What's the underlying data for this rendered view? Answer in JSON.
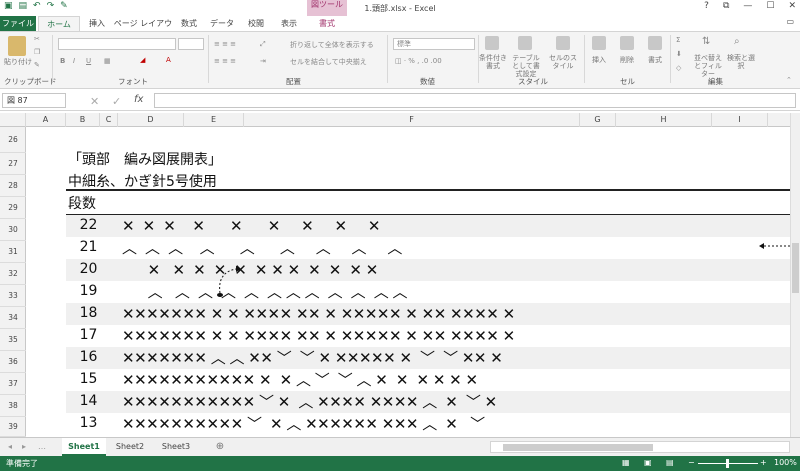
{
  "window": {
    "title": "1.頭部.xlsx - Excel",
    "contextual_group": "図ツール",
    "controls": [
      "?",
      "⧉",
      "—",
      "☐",
      "✕"
    ]
  },
  "tabs": [
    "ファイル",
    "ホーム",
    "挿入",
    "ページ レイアウト",
    "数式",
    "データ",
    "校閲",
    "表示",
    "書式"
  ],
  "ribbon": {
    "clipboard": {
      "paste": "貼り付け",
      "label": "クリップボード"
    },
    "font": {
      "label": "フォント",
      "bold": "B",
      "italic": "I",
      "underline": "U"
    },
    "alignment": {
      "wrap": "折り返して全体を表示する",
      "merge": "セルを結合して中央揃え",
      "label": "配置"
    },
    "number": {
      "format": "標準",
      "label": "数値"
    },
    "styles": {
      "conditional": "条件付き書式",
      "table": "テーブルとして書式設定",
      "cell": "セルのスタイル",
      "label": "スタイル"
    },
    "cells": {
      "insert": "挿入",
      "delete": "削除",
      "format": "書式",
      "label": "セル"
    },
    "editing": {
      "sort": "並べ替えとフィルター",
      "find": "検索と選択",
      "label": "編集"
    }
  },
  "formula": {
    "namebox": "図 87",
    "fx": "fx",
    "value": ""
  },
  "columns": [
    "A",
    "B",
    "C",
    "D",
    "E",
    "F",
    "G",
    "H",
    "I"
  ],
  "rows": [
    "26",
    "27",
    "28",
    "29",
    "30",
    "31",
    "32",
    "33",
    "34",
    "35",
    "36",
    "37",
    "38",
    "39"
  ],
  "sheet": {
    "title": "「頭部　編み図展開表」",
    "subtitle": "中細糸、かぎ針5号使用",
    "header": "段数",
    "stitch_rows": [
      {
        "num": "22",
        "stitches": "✕  ✕  ✕    ✕      ✕      ✕     ✕     ✕     ✕"
      },
      {
        "num": "21",
        "stitches": "︿  ︿  ︿    ︿      ︿      ︿     ︿     ︿     ︿"
      },
      {
        "num": "20",
        "stitches": "      ✕   ✕  ✕  ✕  ✕  ✕ ✕ ✕  ✕  ✕  ✕ ✕"
      },
      {
        "num": "19",
        "stitches": "      ︿   ︿  ︿  ︿  ︿  ︿ ︿ ︿  ︿  ︿  ︿ ︿"
      },
      {
        "num": "18",
        "stitches": "✕✕✕✕✕✕✕ ✕ ✕ ✕✕✕✕ ✕✕ ✕ ✕✕✕✕✕ ✕ ✕✕ ✕✕✕✕ ✕"
      },
      {
        "num": "17",
        "stitches": "✕✕✕✕✕✕✕ ✕ ✕ ✕✕✕✕ ✕✕ ✕ ✕✕✕✕✕ ✕ ✕✕ ✕✕✕✕ ✕"
      },
      {
        "num": "16",
        "stitches": "✕✕✕✕✕✕✕ ︿ ︿ ✕✕ ﹀  ﹀ ✕ ✕✕✕✕✕ ✕  ﹀  ﹀ ✕✕ ✕"
      },
      {
        "num": "15",
        "stitches": "✕✕✕✕✕✕✕✕✕✕✕ ✕  ✕ ︿ ﹀  ﹀ ︿ ✕  ✕  ✕ ✕ ✕ ✕"
      },
      {
        "num": "14",
        "stitches": "✕✕✕✕✕✕✕✕✕✕✕ ﹀ ✕  ︿ ✕✕✕✕ ✕✕✕✕ ︿  ✕  ﹀ ✕"
      },
      {
        "num": "13",
        "stitches": "✕✕✕✕✕✕✕✕✕✕ ﹀  ✕ ︿ ✕✕✕✕✕✕ ✕✕✕ ︿  ✕   ﹀"
      }
    ]
  },
  "sheet_tabs": [
    "Sheet1",
    "Sheet2",
    "Sheet3"
  ],
  "add_sheet": "⊕",
  "status": {
    "ready": "準備完了",
    "zoom": "100%"
  },
  "colors": {
    "accent": "#217346",
    "band": "#f0f0f0",
    "contextual": "#e6c1d4"
  }
}
